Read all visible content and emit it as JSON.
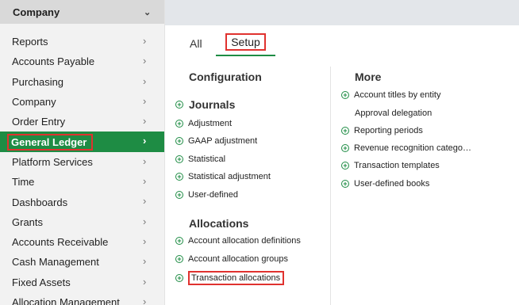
{
  "sidebar": {
    "header": "Company",
    "items": [
      {
        "label": "Reports"
      },
      {
        "label": "Accounts Payable"
      },
      {
        "label": "Purchasing"
      },
      {
        "label": "Company"
      },
      {
        "label": "Order Entry"
      },
      {
        "label": "General Ledger",
        "active": true
      },
      {
        "label": "Platform Services"
      },
      {
        "label": "Time"
      },
      {
        "label": "Dashboards"
      },
      {
        "label": "Grants"
      },
      {
        "label": "Accounts Receivable"
      },
      {
        "label": "Cash Management"
      },
      {
        "label": "Fixed Assets"
      },
      {
        "label": "Allocation Management"
      }
    ]
  },
  "tabs": [
    {
      "label": "All"
    },
    {
      "label": "Setup",
      "active": true
    }
  ],
  "configuration": {
    "title": "Configuration",
    "journals": {
      "title": "Journals",
      "items": [
        "Adjustment",
        "GAAP adjustment",
        "Statistical",
        "Statistical adjustment",
        "User-defined"
      ]
    }
  },
  "allocations": {
    "title": "Allocations",
    "items": [
      "Account allocation definitions",
      "Account allocation groups",
      "Transaction allocations"
    ]
  },
  "more": {
    "title": "More",
    "items": [
      "Account titles by entity",
      "Approval delegation",
      "Reporting periods",
      "Revenue recognition catego…",
      "Transaction templates",
      "User-defined books"
    ]
  },
  "colors": {
    "accent": "#1e8c44",
    "highlight": "#e0322f"
  }
}
